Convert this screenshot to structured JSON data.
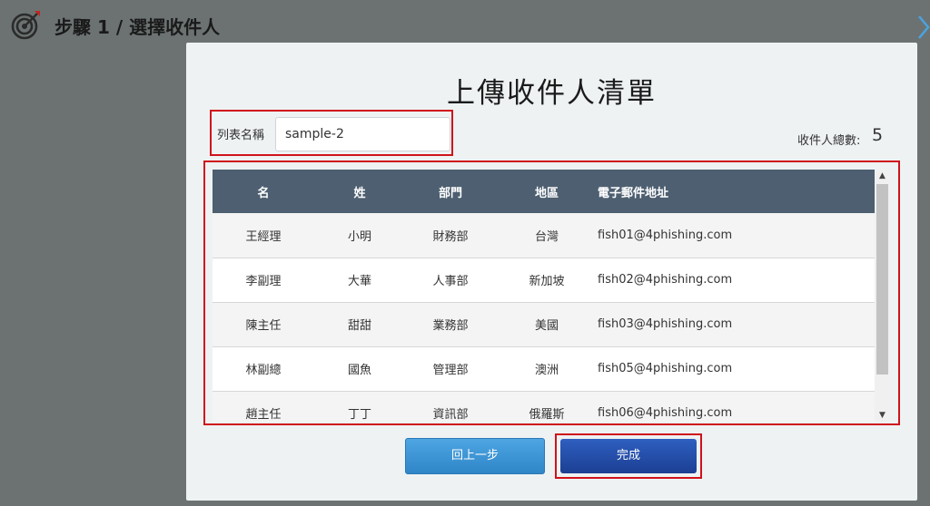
{
  "header": {
    "title": "步驟 1 / 選擇收件人",
    "target_icon": "target-icon",
    "next_icon": "chevron-right-icon"
  },
  "modal": {
    "title": "上傳收件人清單",
    "list_name_label": "列表名稱",
    "list_name_value": "sample-2",
    "recipient_count_label": "收件人總數:",
    "recipient_count": "5",
    "table": {
      "columns": [
        "名",
        "姓",
        "部門",
        "地區",
        "電子郵件地址"
      ],
      "rows": [
        [
          "王經理",
          "小明",
          "財務部",
          "台灣",
          "fish01@4phishing.com"
        ],
        [
          "李副理",
          "大華",
          "人事部",
          "新加坡",
          "fish02@4phishing.com"
        ],
        [
          "陳主任",
          "甜甜",
          "業務部",
          "美國",
          "fish03@4phishing.com"
        ],
        [
          "林副總",
          "國魚",
          "管理部",
          "澳洲",
          "fish05@4phishing.com"
        ],
        [
          "趙主任",
          "丁丁",
          "資訊部",
          "俄羅斯",
          "fish06@4phishing.com"
        ]
      ]
    },
    "back_label": "回上一步",
    "finish_label": "完成"
  },
  "colors": {
    "backdrop": "#6c7272",
    "table_header": "#4d5f70",
    "highlight": "#d0121b",
    "back_button": "#3a93d6",
    "finish_button": "#234da6"
  }
}
